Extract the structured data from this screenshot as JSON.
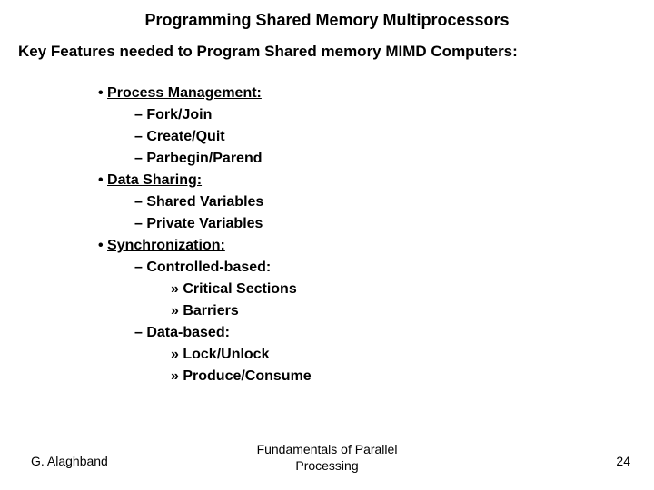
{
  "title": "Programming Shared Memory Multiprocessors",
  "subtitle": "Key Features needed to Program Shared memory MIMD Computers:",
  "outline": {
    "l1_1": " Process Management:",
    "l2_1": "Fork/Join",
    "l2_2": "Create/Quit",
    "l2_3": "Parbegin/Parend",
    "l1_2": "Data Sharing:",
    "l2_4": "Shared Variables",
    "l2_5": "Private Variables",
    "l1_3": "Synchronization:",
    "l2_6": "Controlled-based:",
    "l3_1": "Critical Sections",
    "l3_2": "Barriers",
    "l2_7": "Data-based:",
    "l3_3": "Lock/Unlock",
    "l3_4": "Produce/Consume"
  },
  "footer": {
    "author": "G. Alaghband",
    "center": "Fundamentals of Parallel Processing",
    "page": "24"
  }
}
